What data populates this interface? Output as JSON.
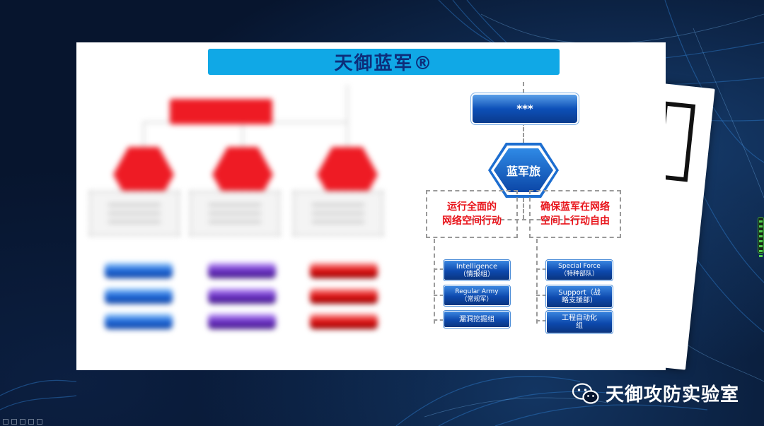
{
  "slide": {
    "title": "天御蓝军®",
    "blurred_chart": {
      "left_col_color": "#1c66d8",
      "mid_col_color": "#6a2fc4",
      "right_col_color": "#e01010"
    },
    "org_chart": {
      "top_node": "***",
      "center_node": "蓝军旅",
      "goal_left": [
        "运行全面的",
        "网络空间行动"
      ],
      "goal_right": [
        "确保蓝军在网络",
        "空间上行动自由"
      ],
      "left_units": [
        {
          "line1": "Intelligence",
          "line2": "（情报组）"
        },
        {
          "line1": "Regular Army",
          "line2": "（常规军）"
        },
        {
          "line1": "漏洞挖掘组",
          "line2": ""
        }
      ],
      "right_units": [
        {
          "line1": "Special Force",
          "line2": "（特种部队）"
        },
        {
          "line1": "Support（战",
          "line2": "略支援部）"
        },
        {
          "line1": "工程自动化",
          "line2": "组"
        }
      ]
    }
  },
  "footer": {
    "brand": "天御攻防实验室"
  },
  "colors": {
    "title_bar": "#10a8e6",
    "accent_red": "#e8141b",
    "node_blue": "#0d50b8"
  }
}
